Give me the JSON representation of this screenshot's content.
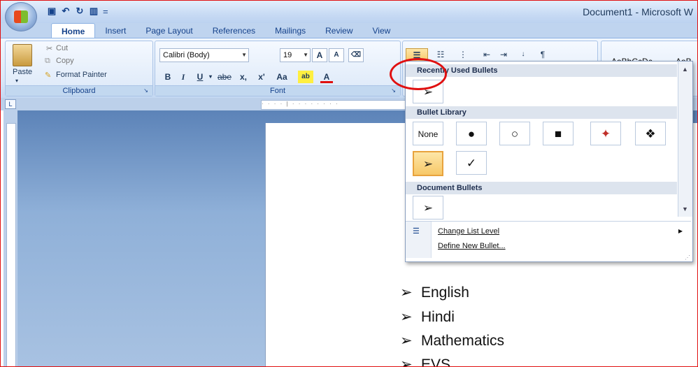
{
  "window": {
    "title": "Document1 - Microsoft W"
  },
  "quick_access": {
    "save_icon": "save-icon",
    "undo_icon": "undo-icon",
    "redo_icon": "redo-icon",
    "customize_icon": "customize-qat-icon",
    "separator": "="
  },
  "tabs": [
    "Home",
    "Insert",
    "Page Layout",
    "References",
    "Mailings",
    "Review",
    "View"
  ],
  "active_tab": "Home",
  "clipboard": {
    "cut": "Cut",
    "copy": "Copy",
    "paste": "Paste",
    "format_painter": "Format Painter",
    "group_label": "Clipboard"
  },
  "font": {
    "family": "Calibri (Body)",
    "size": "19",
    "grow": "A",
    "shrink": "A",
    "bold": "B",
    "italic": "I",
    "underline": "U",
    "strike": "abe",
    "subscript": "x,",
    "superscript": "x'",
    "case": "Aa",
    "highlight": "ab",
    "color": "A",
    "group_label": "Font"
  },
  "styles": {
    "style1": "AaBbCcDc",
    "style2": "AaB"
  },
  "bullet_menu": {
    "recent_header": "Recently Used Bullets",
    "library_header": "Bullet Library",
    "document_header": "Document Bullets",
    "recent": [
      "➢"
    ],
    "library": [
      "None",
      "●",
      "○",
      "■",
      "✦",
      "❖",
      "➢",
      "✓"
    ],
    "document": [
      "➢"
    ],
    "selected_library_index": 6,
    "change_list_level": "Change List Level",
    "define_new_bullet": "Define New Bullet..."
  },
  "document": {
    "bullet": "➢",
    "lines": [
      "English",
      "Hindi",
      "Mathematics",
      "EVS"
    ]
  },
  "colors": {
    "annotation_red": "#e01010",
    "ribbon_blue": "#dae7f8",
    "selection_orange": "#f7c868"
  }
}
